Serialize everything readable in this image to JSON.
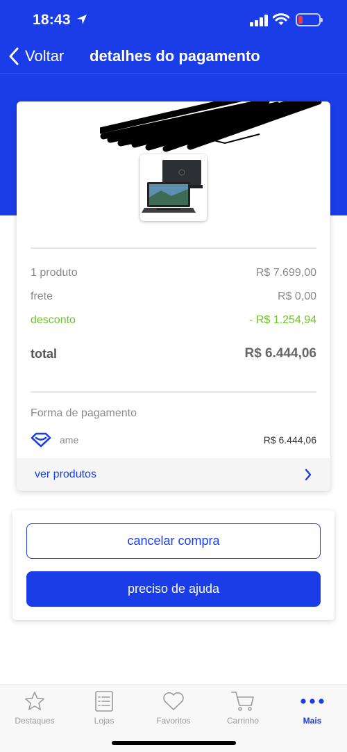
{
  "status_bar": {
    "time": "18:43"
  },
  "nav": {
    "back_label": "Voltar",
    "title": "detalhes do pagamento"
  },
  "summary": {
    "rows": [
      {
        "label": "1 produto",
        "value": "R$ 7.699,00"
      },
      {
        "label": "frete",
        "value": "R$ 0,00"
      },
      {
        "label": "desconto",
        "value": "- R$ 1.254,94"
      }
    ],
    "total": {
      "label": "total",
      "value": "R$ 6.444,06"
    }
  },
  "payment": {
    "heading": "Forma de pagamento",
    "method": "ame",
    "amount": "R$ 6.444,06"
  },
  "view_products": {
    "label": "ver produtos"
  },
  "actions": {
    "cancel_label": "cancelar compra",
    "help_label": "preciso de ajuda"
  },
  "tab_bar": {
    "tabs": [
      {
        "label": "Destaques",
        "icon": "star-icon"
      },
      {
        "label": "Lojas",
        "icon": "list-icon"
      },
      {
        "label": "Favoritos",
        "icon": "heart-icon"
      },
      {
        "label": "Carrinho",
        "icon": "cart-icon"
      },
      {
        "label": "Mais",
        "icon": "more-icon",
        "active": true
      }
    ]
  },
  "colors": {
    "brand_blue": "#1a3de8",
    "discount_green": "#6cc623"
  }
}
